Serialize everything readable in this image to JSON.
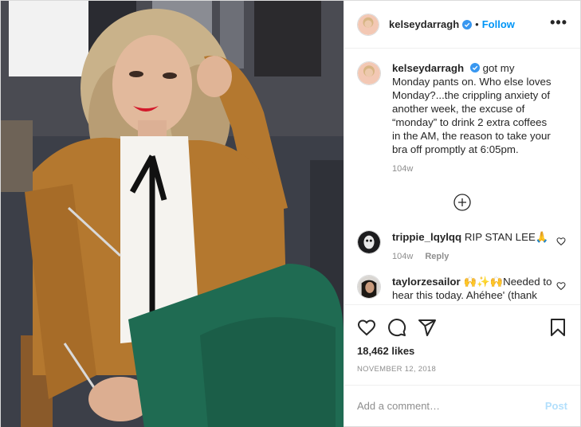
{
  "colors": {
    "accent": "#0095f6",
    "verified": "#3897f0",
    "muted": "#8e8e8e",
    "text": "#262626",
    "post_disabled": "#b2dffc",
    "jacket": "#b4782f",
    "pants": "#1f6b52"
  },
  "header": {
    "username": "kelseydarragh",
    "dot": "•",
    "follow_label": "Follow",
    "more_label": "•••"
  },
  "caption": {
    "username": "kelseydarragh",
    "text": "got my Monday pants on. Who else loves Monday?...the crippling anxiety of another week, the excuse of “monday” to drink 2 extra coffees in the AM, the reason to take your bra off promptly at 6:05pm.",
    "time": "104w"
  },
  "comments": [
    {
      "username": "trippie_lqylqq",
      "text": "RIP STAN LEE🙏",
      "time": "104w",
      "reply_label": "Reply"
    },
    {
      "username": "taylorzesailor",
      "text": "🙌✨🙌Needed to hear this today. Ahéhee' (thank you)!"
    }
  ],
  "likes": "18,462 likes",
  "date": "NOVEMBER 12, 2018",
  "add_comment": {
    "placeholder": "Add a comment…",
    "post_label": "Post"
  },
  "icons": {
    "header_more": "more-options-icon",
    "load_more": "plus-circle-icon",
    "like": "heart-icon",
    "comment": "comment-icon",
    "share": "share-icon",
    "save": "bookmark-icon",
    "verified": "verified-badge-icon"
  }
}
